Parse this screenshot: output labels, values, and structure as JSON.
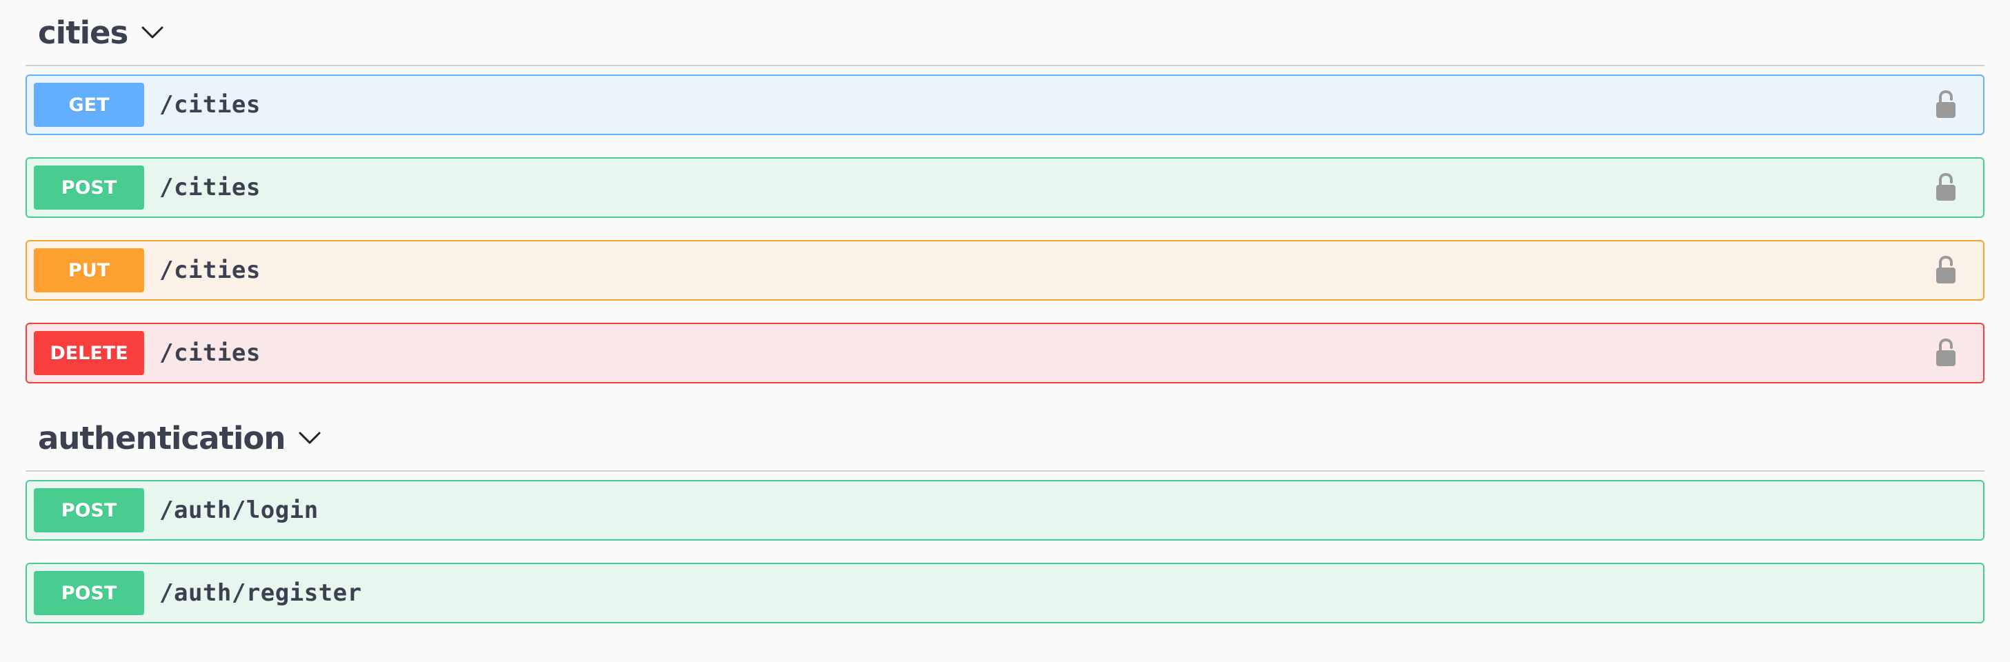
{
  "sections": [
    {
      "title": "cities",
      "operations": [
        {
          "method": "GET",
          "path": "/cities"
        },
        {
          "method": "POST",
          "path": "/cities"
        },
        {
          "method": "PUT",
          "path": "/cities"
        },
        {
          "method": "DELETE",
          "path": "/cities"
        }
      ]
    },
    {
      "title": "authentication",
      "operations": [
        {
          "method": "POST",
          "path": "/auth/login"
        },
        {
          "method": "POST",
          "path": "/auth/register"
        }
      ]
    }
  ],
  "colors": {
    "get": "#61affe",
    "post": "#49cc90",
    "put": "#fca130",
    "delete": "#f93e3e",
    "title": "#3b4151",
    "lock": "#999999"
  },
  "icons": {
    "expand": "chevron-down-icon",
    "lock": "unlocked-padlock-icon"
  }
}
